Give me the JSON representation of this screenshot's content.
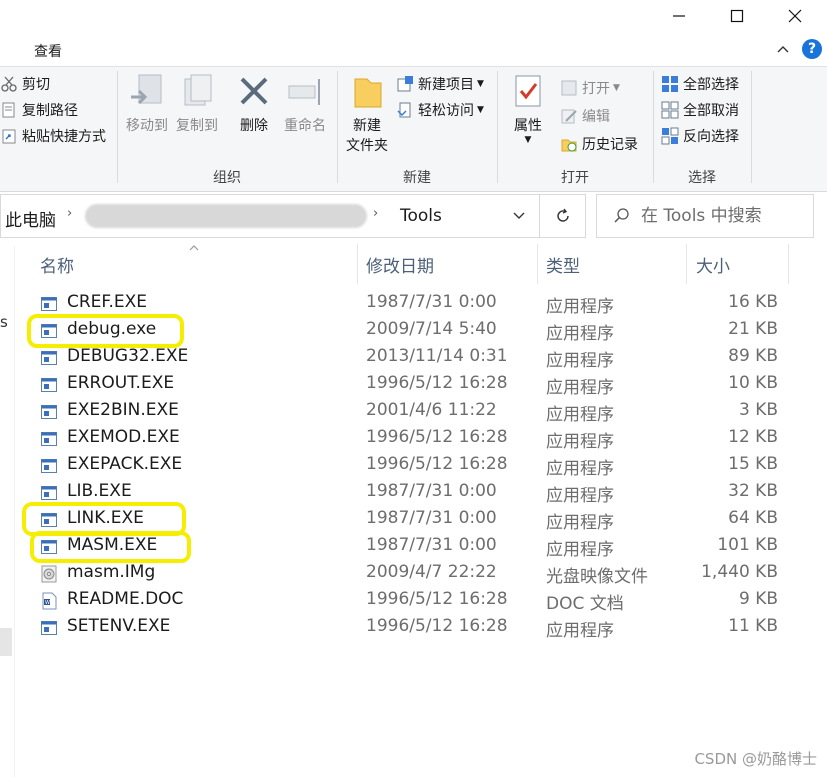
{
  "window": {
    "menu_tab": "查看",
    "help": "?"
  },
  "ribbon": {
    "clipboard": {
      "cut": "剪切",
      "copy_path": "复制路径",
      "paste_shortcut": "粘贴快捷方式"
    },
    "organize": {
      "label": "组织",
      "move_to": "移动到",
      "copy_to": "复制到",
      "delete": "删除",
      "rename": "重命名"
    },
    "new": {
      "label": "新建",
      "new_folder_line1": "新建",
      "new_folder_line2": "文件夹",
      "new_item": "新建项目",
      "easy_access": "轻松访问"
    },
    "open": {
      "label": "打开",
      "properties": "属性",
      "open": "打开",
      "edit": "编辑",
      "history": "历史记录"
    },
    "select": {
      "label": "选择",
      "select_all": "全部选择",
      "select_none": "全部取消",
      "invert": "反向选择"
    }
  },
  "address": {
    "root": "此电脑",
    "current": "Tools",
    "search_placeholder": "在 Tools 中搜索"
  },
  "columns": {
    "name": "名称",
    "modified": "修改日期",
    "type": "类型",
    "size": "大小"
  },
  "files": [
    {
      "name": "CREF.EXE",
      "modified": "1987/7/31 0:00",
      "type": "应用程序",
      "size": "16 KB",
      "icon": "exe-icon"
    },
    {
      "name": "debug.exe",
      "modified": "2009/7/14 5:40",
      "type": "应用程序",
      "size": "21 KB",
      "icon": "exe-icon"
    },
    {
      "name": "DEBUG32.EXE",
      "modified": "2013/11/14 0:31",
      "type": "应用程序",
      "size": "89 KB",
      "icon": "exe-icon"
    },
    {
      "name": "ERROUT.EXE",
      "modified": "1996/5/12 16:28",
      "type": "应用程序",
      "size": "10 KB",
      "icon": "exe-icon"
    },
    {
      "name": "EXE2BIN.EXE",
      "modified": "2001/4/6 11:22",
      "type": "应用程序",
      "size": "3 KB",
      "icon": "exe-icon"
    },
    {
      "name": "EXEMOD.EXE",
      "modified": "1996/5/12 16:28",
      "type": "应用程序",
      "size": "12 KB",
      "icon": "exe-icon"
    },
    {
      "name": "EXEPACK.EXE",
      "modified": "1996/5/12 16:28",
      "type": "应用程序",
      "size": "15 KB",
      "icon": "exe-icon"
    },
    {
      "name": "LIB.EXE",
      "modified": "1987/7/31 0:00",
      "type": "应用程序",
      "size": "32 KB",
      "icon": "exe-icon"
    },
    {
      "name": "LINK.EXE",
      "modified": "1987/7/31 0:00",
      "type": "应用程序",
      "size": "64 KB",
      "icon": "exe-icon"
    },
    {
      "name": "MASM.EXE",
      "modified": "1987/7/31 0:00",
      "type": "应用程序",
      "size": "101 KB",
      "icon": "exe-icon"
    },
    {
      "name": "masm.IMg",
      "modified": "2009/4/7 22:22",
      "type": "光盘映像文件",
      "size": "1,440 KB",
      "icon": "disc-image-icon"
    },
    {
      "name": "README.DOC",
      "modified": "1996/5/12 16:28",
      "type": "DOC 文档",
      "size": "9 KB",
      "icon": "doc-icon"
    },
    {
      "name": "SETENV.EXE",
      "modified": "1996/5/12 16:28",
      "type": "应用程序",
      "size": "11 KB",
      "icon": "exe-icon"
    }
  ],
  "highlighted": [
    "debug.exe",
    "LINK.EXE",
    "MASM.EXE"
  ],
  "colors": {
    "highlight": "#f5ee00",
    "accent": "#0078d7"
  },
  "watermark": "CSDN @奶酪博士"
}
